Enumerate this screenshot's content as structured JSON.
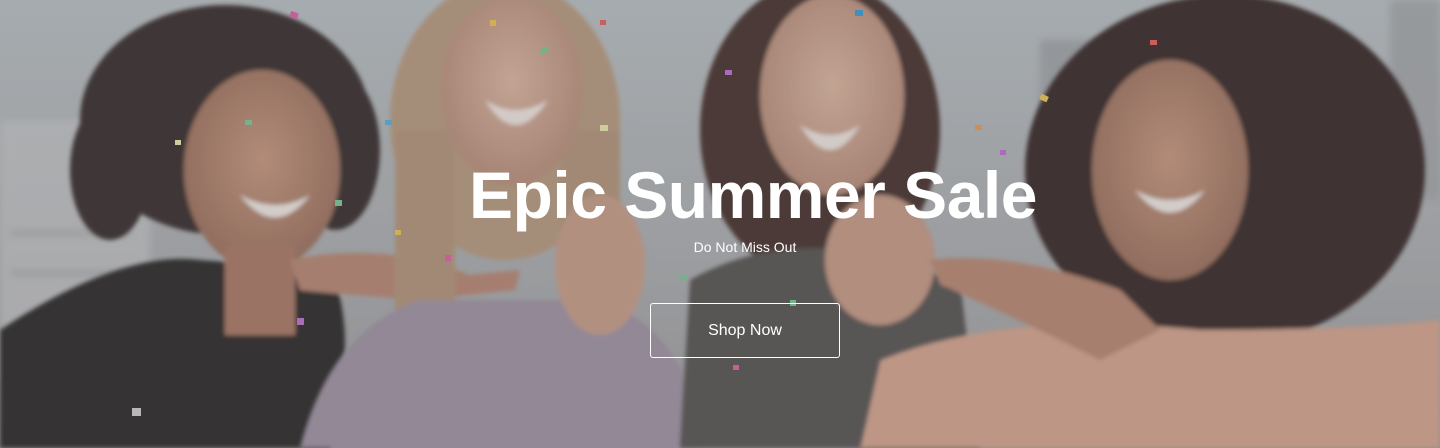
{
  "hero": {
    "title": "Epic Summer Sale",
    "subtitle": "Do Not Miss Out",
    "cta_label": "Shop Now",
    "overlay_color": "#786e6e",
    "text_color": "#ffffff"
  }
}
